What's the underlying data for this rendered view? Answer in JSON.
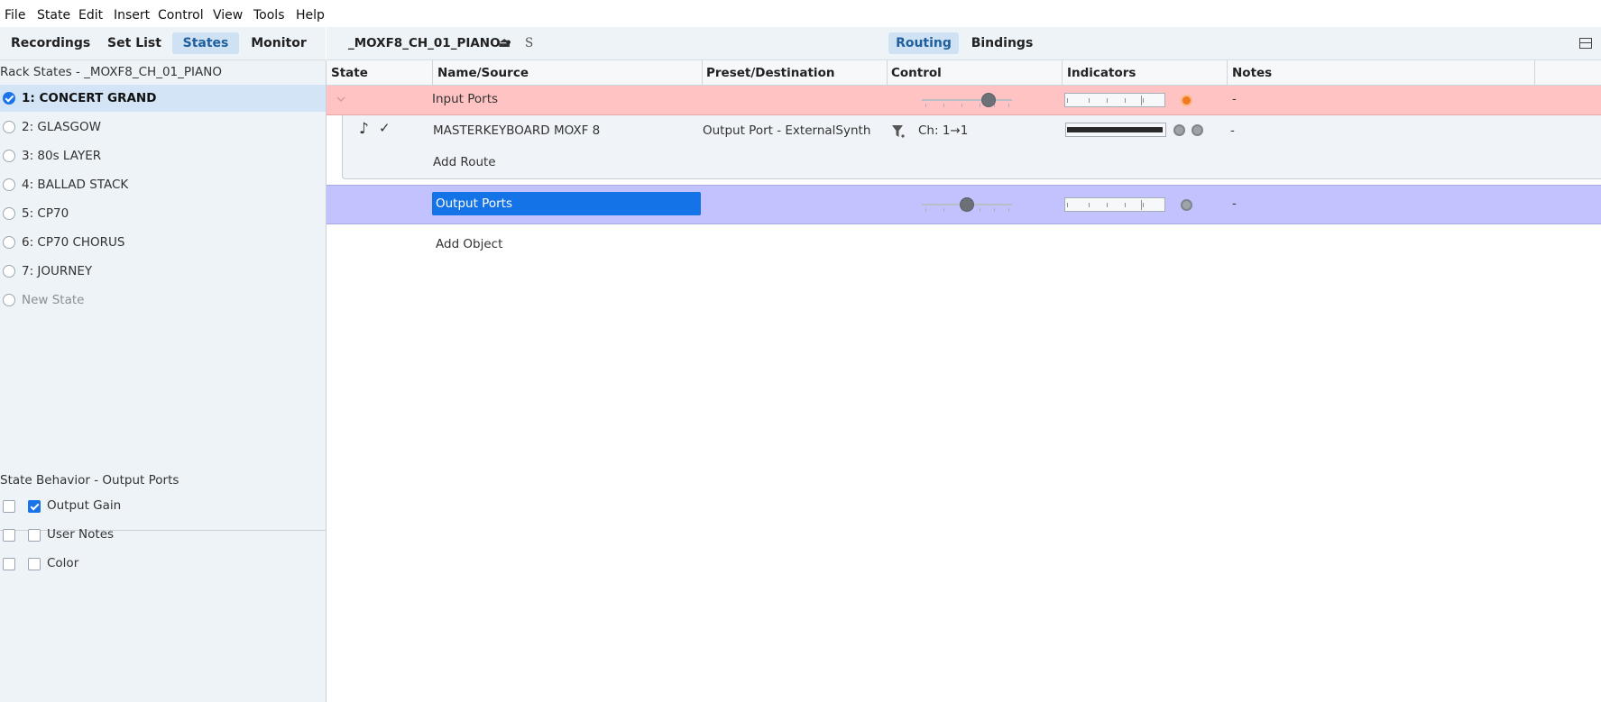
{
  "menu": [
    "File",
    "State",
    "Edit",
    "Insert",
    "Control",
    "View",
    "Tools",
    "Help"
  ],
  "left_tabs": {
    "recordings": "Recordings",
    "setlist": "Set List",
    "states": "States",
    "monitor": "Monitor",
    "active": "States"
  },
  "rack_states": {
    "title": "Rack States - _MOXF8_CH_01_PIANO",
    "items": [
      {
        "label": "1: CONCERT GRAND",
        "selected": true
      },
      {
        "label": "2: GLASGOW",
        "selected": false
      },
      {
        "label": "3: 80s LAYER",
        "selected": false
      },
      {
        "label": "4: BALLAD STACK",
        "selected": false
      },
      {
        "label": "5: CP70",
        "selected": false
      },
      {
        "label": "6: CP70 CHORUS",
        "selected": false
      },
      {
        "label": "7: JOURNEY",
        "selected": false
      }
    ],
    "new_state": "New State"
  },
  "behavior": {
    "title": "State Behavior - Output Ports",
    "items": [
      {
        "label": "Output Gain",
        "left_checked": false,
        "checked": true
      },
      {
        "label": "User Notes",
        "left_checked": false,
        "checked": false
      },
      {
        "label": "Color",
        "left_checked": false,
        "checked": false
      }
    ]
  },
  "toolbar": {
    "rack_name": "_MOXF8_CH_01_PIANO •",
    "eject_glyph": "⏏",
    "s_glyph": "S",
    "routing": "Routing",
    "bindings": "Bindings",
    "active_view": "Routing"
  },
  "columns": {
    "state": "State",
    "name_source": "Name/Source",
    "preset_destination": "Preset/Destination",
    "control": "Control",
    "indicators": "Indicators",
    "notes": "Notes"
  },
  "rows": {
    "input_ports": {
      "name": "Input Ports",
      "notes": "-",
      "gain_level": 0.78,
      "led_active": true,
      "color": "#ffc3c3"
    },
    "route": {
      "midi_glyph": "♪",
      "check_glyph": "✓",
      "source": "MASTERKEYBOARD MOXF 8",
      "destination": "Output Port - ExternalSynth",
      "channel": "Ch: 1→1",
      "notes": "-",
      "meter_level": 0.98
    },
    "add_route": "Add Route",
    "output_ports": {
      "name": "Output Ports",
      "notes": "-",
      "gain_level": 0.5,
      "led_active": false,
      "color": "#c2c2ff"
    },
    "add_object": "Add Object"
  },
  "colors": {
    "accent": "#1a73e8",
    "selection_bg": "#d2e4f6",
    "panel_bg": "#eef3f8",
    "led_on": "#f07a20"
  }
}
